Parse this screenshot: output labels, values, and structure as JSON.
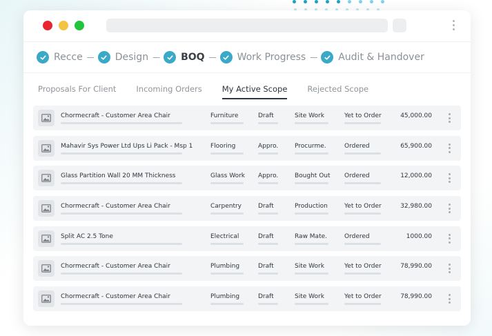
{
  "progress_steps": [
    {
      "label": "Recce",
      "done": true,
      "active": false
    },
    {
      "label": "Design",
      "done": true,
      "active": false
    },
    {
      "label": "BOQ",
      "done": true,
      "active": true
    },
    {
      "label": "Work Progress",
      "done": true,
      "active": false
    },
    {
      "label": "Audit & Handover",
      "done": true,
      "active": false
    }
  ],
  "step_separator": "---",
  "tabs": [
    {
      "label": "Proposals For Client",
      "active": false
    },
    {
      "label": "Incoming Orders",
      "active": false
    },
    {
      "label": "My Active Scope",
      "active": true
    },
    {
      "label": "Rejected Scope",
      "active": false
    }
  ],
  "rows": [
    {
      "name": "Chormecraft - Customer Area Chair",
      "category": "Furniture",
      "status": "Draft",
      "type": "Site Work",
      "order": "Yet to Order",
      "amount": "45,000.00"
    },
    {
      "name": "Mahavir Sys Power Ltd Ups Li Pack - Msp 1",
      "category": "Flooring",
      "status": "Appro.",
      "type": "Procurme.",
      "order": "Ordered",
      "amount": "65,900.00"
    },
    {
      "name": "Glass Partition Wall 20 MM Thickness",
      "category": "Glass Work",
      "status": "Appro.",
      "type": "Bought Out",
      "order": "Ordered",
      "amount": "12,000.00"
    },
    {
      "name": "Chormecraft - Customer Area Chair",
      "category": "Carpentry",
      "status": "Draft",
      "type": "Production",
      "order": "Yet to Order",
      "amount": "32,980.00"
    },
    {
      "name": "Split AC 2.5 Tone",
      "category": "Electrical",
      "status": "Draft",
      "type": "Raw Mate.",
      "order": "Ordered",
      "amount": "1000.00"
    },
    {
      "name": "Chormecraft - Customer Area Chair",
      "category": "Plumbing",
      "status": "Draft",
      "type": "Site Work",
      "order": "Yet to Order",
      "amount": "78,990.00"
    },
    {
      "name": "Chormecraft - Customer Area Chair",
      "category": "Plumbing",
      "status": "Draft",
      "type": "Site Work",
      "order": "Yet to Order",
      "amount": "78,990.00"
    }
  ],
  "colors": {
    "accent": "#3aa9c8",
    "traffic_red": "#e8262d",
    "traffic_yellow": "#f5c343",
    "traffic_green": "#22c33d"
  },
  "icons": {
    "step": "check-circle-icon",
    "row_thumb": "image-placeholder-icon",
    "row_menu": "kebab-menu-icon"
  }
}
